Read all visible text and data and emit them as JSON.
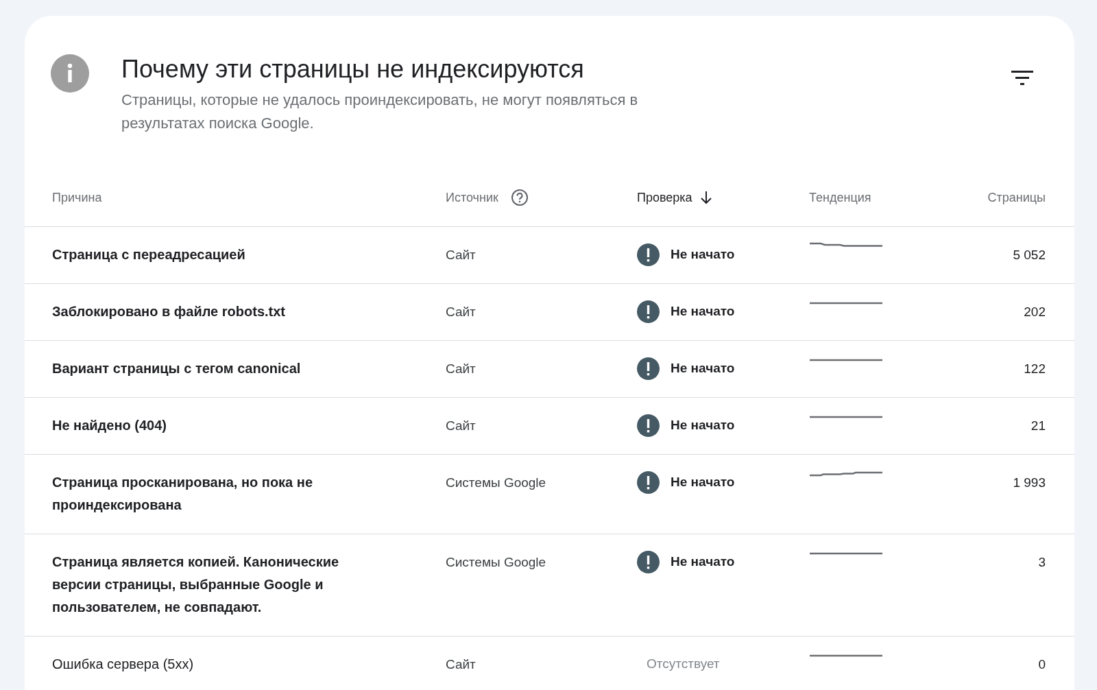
{
  "header": {
    "title": "Почему эти страницы не индексируются",
    "description": "Страницы, которые не удалось проиндексировать, не могут появляться в результатах поиска Google."
  },
  "table": {
    "columns": [
      {
        "label": "Причина",
        "active": false,
        "kind": "plain"
      },
      {
        "label": "Источник",
        "active": false,
        "kind": "help"
      },
      {
        "label": "Проверка",
        "active": true,
        "kind": "sorted"
      },
      {
        "label": "Тенденция",
        "active": false,
        "kind": "plain"
      },
      {
        "label": "Страницы",
        "active": false,
        "kind": "plain"
      }
    ],
    "rows": [
      {
        "reason": "Страница с переадресацией",
        "bold": true,
        "source": "Сайт",
        "status": {
          "kind": "not_started",
          "label": "Не начато"
        },
        "trend": {
          "kind": "down"
        },
        "pages": "5 052"
      },
      {
        "reason": "Заблокировано в файле robots.txt",
        "bold": true,
        "source": "Сайт",
        "status": {
          "kind": "not_started",
          "label": "Не начато"
        },
        "trend": {
          "kind": "flat"
        },
        "pages": "202"
      },
      {
        "reason": "Вариант страницы с тегом canonical",
        "bold": true,
        "source": "Сайт",
        "status": {
          "kind": "not_started",
          "label": "Не начато"
        },
        "trend": {
          "kind": "flat"
        },
        "pages": "122"
      },
      {
        "reason": "Не найдено (404)",
        "bold": true,
        "source": "Сайт",
        "status": {
          "kind": "not_started",
          "label": "Не начато"
        },
        "trend": {
          "kind": "flat"
        },
        "pages": "21"
      },
      {
        "reason": "Страница просканирована, но пока не проиндексирована",
        "bold": true,
        "source": "Системы Google",
        "status": {
          "kind": "not_started",
          "label": "Не начато"
        },
        "trend": {
          "kind": "up"
        },
        "pages": "1 993"
      },
      {
        "reason": "Страница является копией. Канонические версии страницы, выбранные Google и пользователем, не совпадают.",
        "bold": true,
        "source": "Системы Google",
        "status": {
          "kind": "not_started",
          "label": "Не начато"
        },
        "trend": {
          "kind": "flat"
        },
        "pages": "3"
      },
      {
        "reason": "Ошибка сервера (5xx)",
        "bold": false,
        "source": "Сайт",
        "status": {
          "kind": "none",
          "label": "Отсутствует"
        },
        "trend": {
          "kind": "flat"
        },
        "pages": "0"
      }
    ]
  }
}
